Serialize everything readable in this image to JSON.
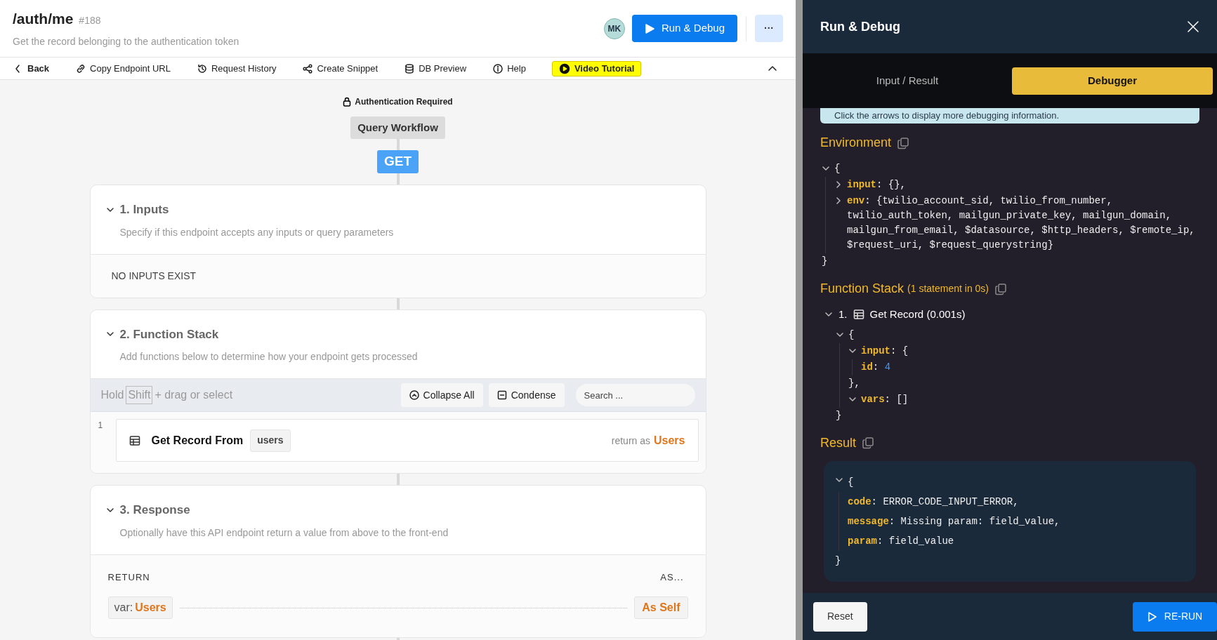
{
  "header": {
    "title": "/auth/me",
    "id": "#188",
    "subtitle": "Get the record belonging to the authentication token",
    "avatar": "MK",
    "run_button": "Run & Debug",
    "more_button": "···"
  },
  "toolbar": [
    {
      "kind": "back",
      "label": "Back"
    },
    {
      "kind": "link",
      "label": "Copy Endpoint URL"
    },
    {
      "kind": "history",
      "label": "Request History"
    },
    {
      "kind": "share",
      "label": "Create Snippet"
    },
    {
      "kind": "db",
      "label": "DB Preview"
    },
    {
      "kind": "info",
      "label": "Help"
    },
    {
      "kind": "video",
      "label": "Video Tutorial"
    }
  ],
  "auth_label": "Authentication Required",
  "workflow_label": "Query Workflow",
  "method": "GET",
  "inputs": {
    "title": "1. Inputs",
    "description": "Specify if this endpoint accepts any inputs or query parameters",
    "expanded": true,
    "empty_text": "NO INPUTS EXIST"
  },
  "function_stack": {
    "title": "2. Function Stack",
    "description": "Add functions below to determine how your endpoint gets processed",
    "expanded": true,
    "hint_parts": [
      "Hold",
      "Shift",
      "+ drag or select"
    ],
    "collapse_button": "Collapse All",
    "condense_button": "Condense",
    "search_placeholder": "Search ...",
    "items": [
      {
        "number": "1",
        "label": "Get Record From",
        "table": "users",
        "return_prefix": "return as",
        "return_var": "Users"
      }
    ]
  },
  "response": {
    "title": "3. Response",
    "description": "Optionally have this API endpoint return a value from above to the front-end",
    "expanded": true,
    "return_label": "RETURN",
    "as_label": "AS...",
    "var_prefix": "var:",
    "var_name": "Users",
    "as_value": "As Self"
  },
  "panel": {
    "title": "Run & Debug",
    "tabs": [
      {
        "label": "Input / Result",
        "selected": false
      },
      {
        "label": "Debugger",
        "selected": true
      }
    ],
    "notice": "Click the arrows to display more debugging information.",
    "environment": {
      "title": "Environment",
      "tree": {
        "open": "{",
        "expanded": true,
        "close": "}",
        "children": [
          {
            "key": "input",
            "value": ": {},",
            "expanded": false
          },
          {
            "key": "env",
            "value": ": {twilio_account_sid, twilio_from_number, twilio_auth_token, mailgun_private_key, mailgun_domain, mailgun_from_email, $datasource, $http_headers, $remote_ip, $request_uri, $request_querystring}",
            "expanded": false
          }
        ]
      }
    },
    "function_stack": {
      "title": "Function Stack",
      "meta": "(1 statement in 0s)",
      "steps": [
        {
          "number": "1.",
          "label": "Get Record (0.001s)",
          "expanded": true,
          "tree": {
            "open": "{",
            "expanded": true,
            "close": "}",
            "children": [
              {
                "key": "input",
                "value": ": {",
                "expanded": true,
                "close": "},",
                "children": [
                  {
                    "key": "id",
                    "separator": ": ",
                    "value": "4",
                    "kind": "number"
                  }
                ]
              },
              {
                "key": "vars",
                "value": ": []",
                "expanded": true
              }
            ]
          }
        }
      ]
    },
    "result": {
      "title": "Result",
      "tree": {
        "open": "{",
        "expanded": true,
        "close": "}",
        "children": [
          {
            "key": "code",
            "value": ": ERROR_CODE_INPUT_ERROR,"
          },
          {
            "key": "message",
            "value": ": Missing param: field_value,"
          },
          {
            "key": "param",
            "value": ": field_value"
          }
        ]
      }
    },
    "reset_button": "Reset",
    "rerun_button": "RE-RUN"
  }
}
